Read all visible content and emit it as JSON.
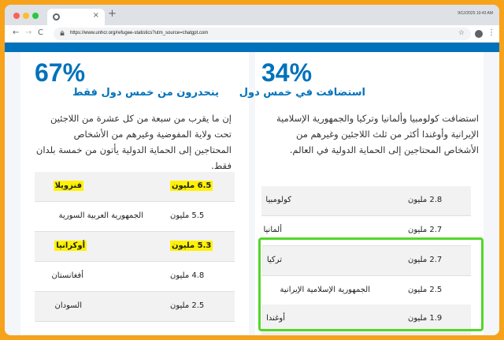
{
  "browser": {
    "url": "https://www.unhcr.org/refugee-statistics?utm_source=chatgpt.com",
    "datetime": "9/12/2025 10:43 AM",
    "tab_title": "",
    "tab_close": "×",
    "new_tab": "+",
    "nav_back": "←",
    "nav_forward": "→",
    "nav_reload": "C",
    "bookmark": "☆",
    "menu": "⋮"
  },
  "right_card": {
    "percent": "34%",
    "heading": "استضافت في خمس دول",
    "paragraph": "استضافت كولومبيا وألمانيا وتركيا والجمهورية الإسلامية الإيرانية وأوغندا أكثر من ثلث اللاجئين وغيرهم من الأشخاص المحتاجين إلى الحماية الدولية في العالم.",
    "rows": [
      {
        "name": "كولومبيا",
        "value": "2.8 مليون"
      },
      {
        "name": "ألمانيا",
        "value": "2.7 مليون"
      },
      {
        "name": "تركيا",
        "value": "2.7 مليون"
      },
      {
        "name": "الجمهورية الإسلامية الإيرانية",
        "value": "2.5 مليون"
      },
      {
        "name": "أوغندا",
        "value": "1.9 مليون"
      }
    ]
  },
  "left_card": {
    "percent": "67%",
    "heading": "ينحدرون من خمس دول فقط",
    "paragraph": "إن ما يقرب من سبعة من كل عشرة من اللاجئين تحت ولاية المفوضية وغيرهم من الأشخاص المحتاجين إلى الحماية الدولية يأتون من خمسة بلدان فقط.",
    "rows": [
      {
        "name": "فنزويلا",
        "value": "6.5 مليون",
        "highlight": true
      },
      {
        "name": "الجمهورية العربية السورية",
        "value": "5.5 مليون",
        "highlight": false
      },
      {
        "name": "أوكرانيا",
        "value": "5.3 مليون",
        "highlight": true
      },
      {
        "name": "أفغانستان",
        "value": "4.8 مليون",
        "highlight": false
      },
      {
        "name": "السودان",
        "value": "2.5 مليون",
        "highlight": false
      }
    ]
  },
  "colors": {
    "frame": "#f6a21a",
    "brand_blue": "#0072bc",
    "highlight": "#fff200",
    "annotation_green": "#53d62a"
  }
}
